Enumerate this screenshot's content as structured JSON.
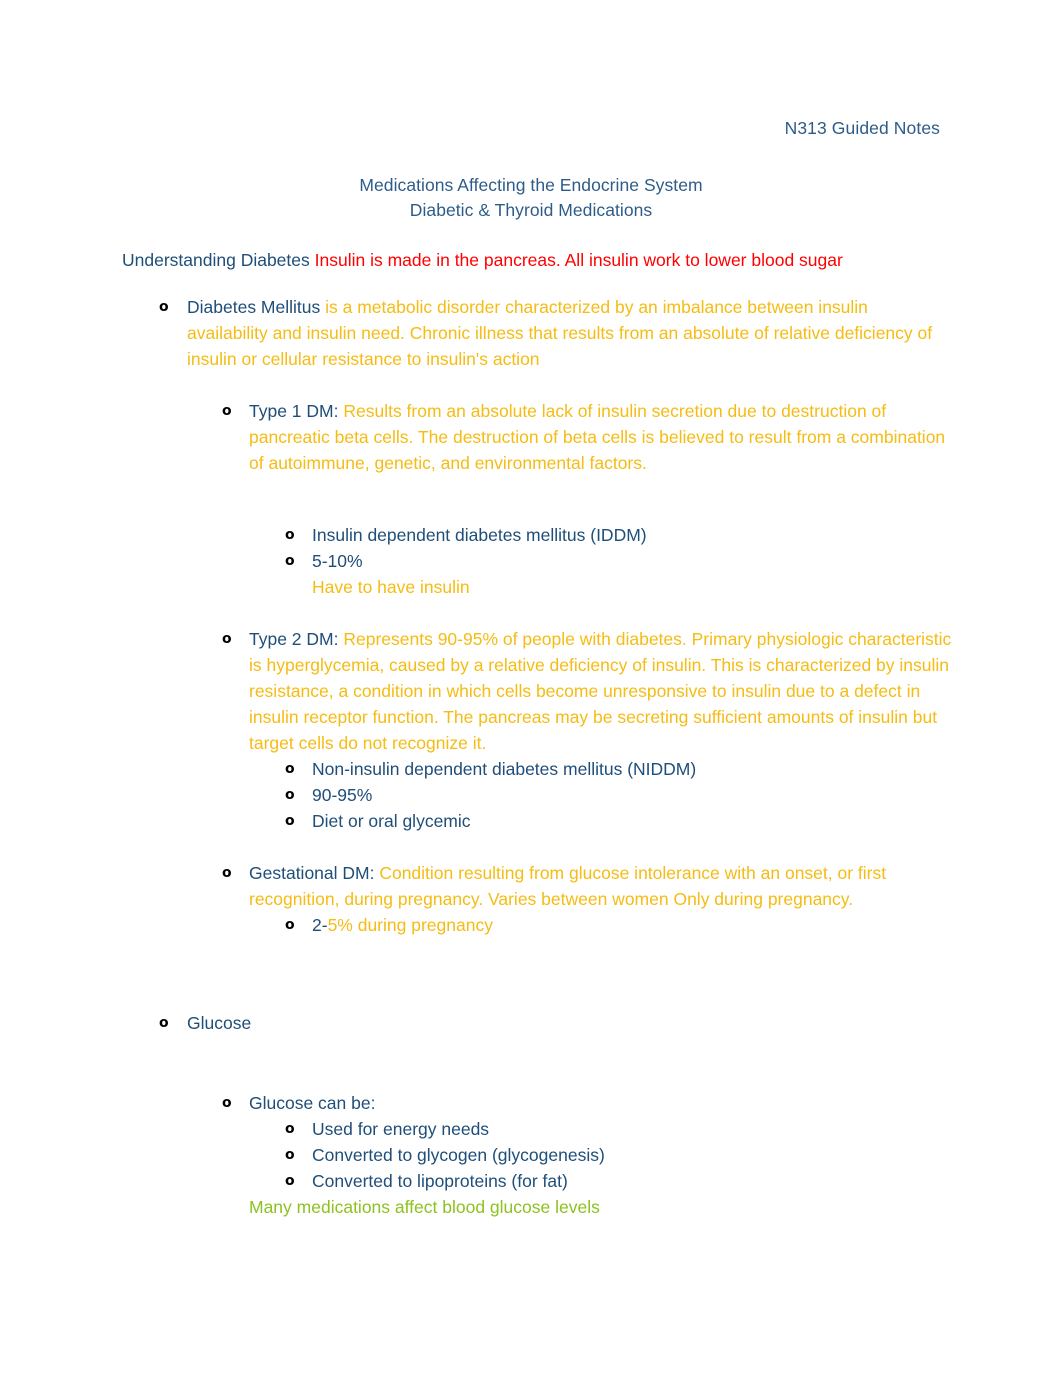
{
  "document": {
    "header_right": "N313 Guided Notes",
    "title_line_1": "Medications Affecting the Endocrine System",
    "title_line_2": "Diabetic & Thyroid Medications"
  },
  "colors": {
    "heading_blue": "#2E5C8A",
    "body_orange": "#F5BC14",
    "accent_red": "#FF0000",
    "accent_green": "#8DC220",
    "bullet_black": "#000000"
  },
  "bullet_glyph": "o",
  "section_heading": {
    "label": "Understanding Diabetes ",
    "note": "Insulin is made in the pancreas. All insulin work to lower blood sugar"
  },
  "outline": {
    "diabetes_mellitus": {
      "term": "Diabetes Mellitus ",
      "definition": "is a metabolic disorder characterized by an imbalance between insulin availability and insulin need.  Chronic illness that results from an absolute of relative deficiency of insulin or cellular resistance to insulin's action"
    },
    "type1": {
      "term": "Type 1 DM: ",
      "definition": "Results from an absolute lack of insulin secretion due to destruction of pancreatic beta cells. The destruction of beta cells is believed to result from a combination of autoimmune, genetic, and environmental factors.",
      "sub": [
        "Insulin dependent diabetes mellitus (IDDM)",
        "5-10%"
      ],
      "note": "Have to have insulin"
    },
    "type2": {
      "term": "Type 2 DM:  ",
      "definition": "Represents 90-95% of people with diabetes. Primary physiologic characteristic is hyperglycemia, caused by a relative deficiency of insulin. This is characterized by insulin resistance, a condition in which cells become unresponsive to insulin due to a defect in insulin receptor function. The pancreas may be secreting sufficient amounts of insulin but target cells do not recognize it.",
      "sub": [
        "Non-insulin dependent diabetes mellitus (NIDDM)",
        "90-95%",
        "Diet or oral glycemic"
      ]
    },
    "gestational": {
      "term": "Gestational DM: ",
      "definition": "Condition resulting from glucose intolerance with an onset, or first recognition, during pregnancy. Varies between women Only during pregnancy.",
      "sub_prefix": "2-",
      "sub_suffix": "5% during pregnancy"
    },
    "glucose": {
      "heading": "Glucose",
      "can_be_label": "Glucose can be:",
      "uses": [
        "Used for energy needs",
        "Converted to glycogen (glycogenesis)",
        "Converted to lipoproteins (for fat)"
      ],
      "note": "Many medications affect blood glucose levels"
    }
  }
}
